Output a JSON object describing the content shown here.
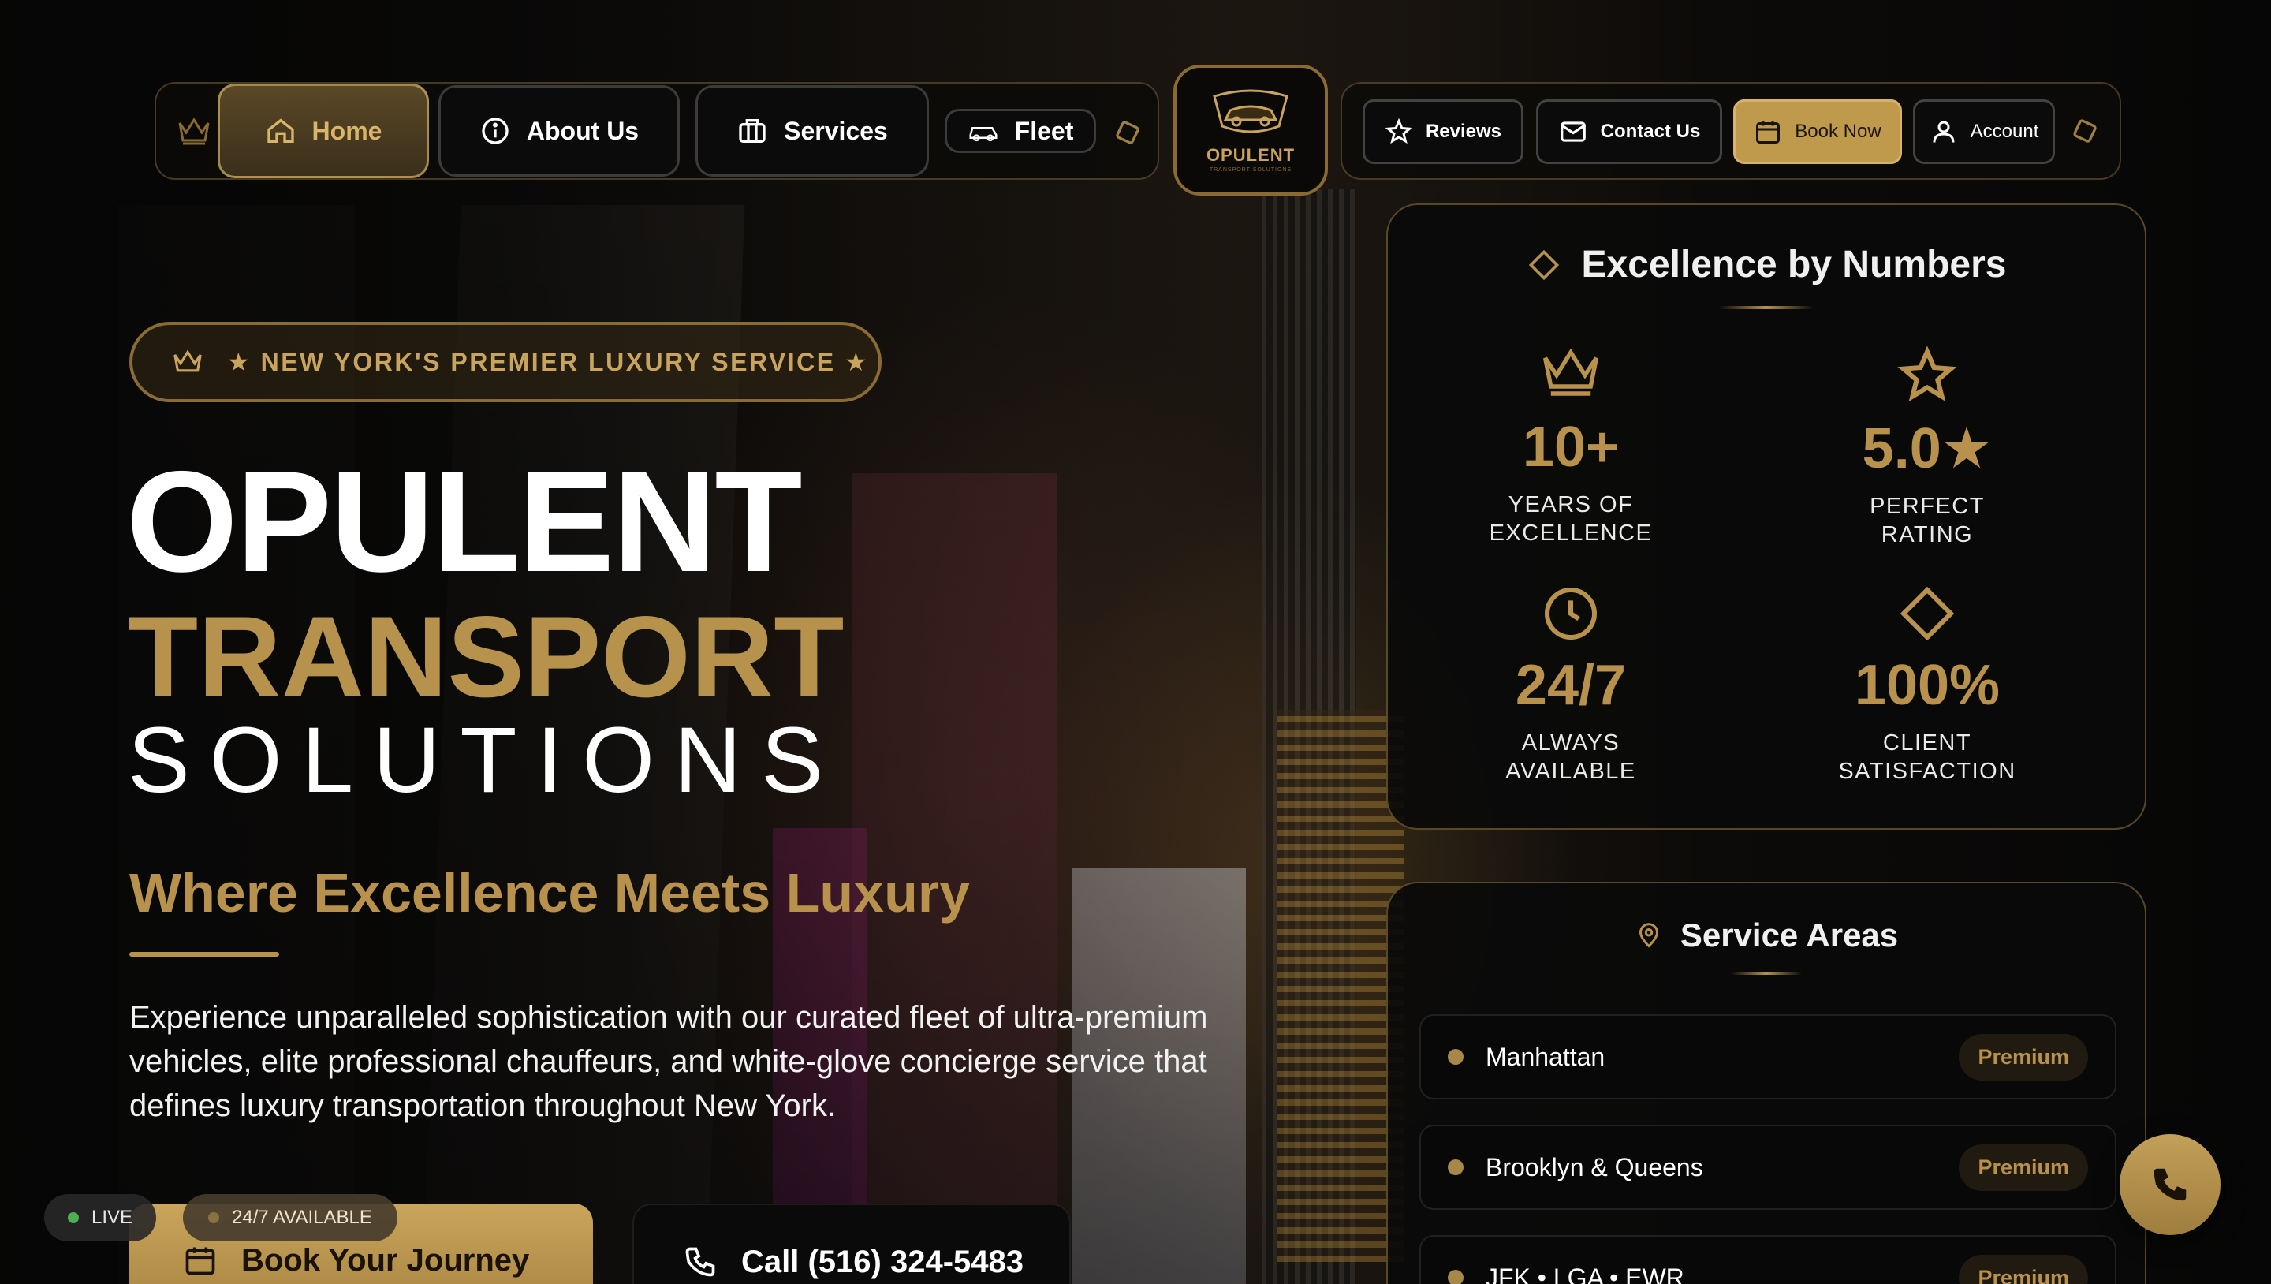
{
  "nav": {
    "left_items": [
      {
        "label": "Home",
        "icon": "home-icon",
        "active": true
      },
      {
        "label": "About Us",
        "icon": "info-icon"
      },
      {
        "label": "Services",
        "icon": "briefcase-icon"
      },
      {
        "label": "Fleet",
        "icon": "car-icon"
      }
    ],
    "right_items": [
      {
        "label": "Reviews",
        "icon": "star-icon"
      },
      {
        "label": "Contact Us",
        "icon": "mail-icon"
      },
      {
        "label": "Book Now",
        "icon": "calendar-icon"
      },
      {
        "label": "Account",
        "icon": "user-icon"
      }
    ],
    "logo": {
      "name": "OPULENT",
      "sub": "TRANSPORT SOLUTIONS"
    }
  },
  "hero": {
    "badge": "★ NEW YORK'S PREMIER LUXURY SERVICE ★",
    "title_1": "OPULENT",
    "title_2": "TRANSPORT",
    "title_3": "SOLUTIONS",
    "tagline": "Where Excellence Meets Luxury",
    "description": "Experience unparalleled sophistication with our curated fleet of ultra-premium vehicles, elite professional chauffeurs, and white-glove concierge service that defines luxury transportation throughout New York.",
    "cta_book": "Book Your Journey",
    "cta_call": "Call (516) 324-5483",
    "status_live": "LIVE",
    "status_available": "24/7 AVAILABLE"
  },
  "stats": {
    "title": "Excellence by Numbers",
    "items": [
      {
        "value": "10+",
        "label_1": "YEARS OF",
        "label_2": "EXCELLENCE",
        "icon": "crown-icon"
      },
      {
        "value": "5.0★",
        "label_1": "PERFECT",
        "label_2": "RATING",
        "icon": "star-icon"
      },
      {
        "value": "24/7",
        "label_1": "ALWAYS",
        "label_2": "AVAILABLE",
        "icon": "clock-icon"
      },
      {
        "value": "100%",
        "label_1": "CLIENT",
        "label_2": "SATISFACTION",
        "icon": "diamond-icon"
      }
    ]
  },
  "areas": {
    "title": "Service Areas",
    "items": [
      {
        "name": "Manhattan",
        "badge": "Premium"
      },
      {
        "name": "Brooklyn & Queens",
        "badge": "Premium"
      },
      {
        "name": "JFK • LGA • EWR",
        "badge": "Premium"
      }
    ]
  },
  "colors": {
    "gold": "#b8924d",
    "background": "#050505",
    "live_dot": "#4caf50"
  }
}
